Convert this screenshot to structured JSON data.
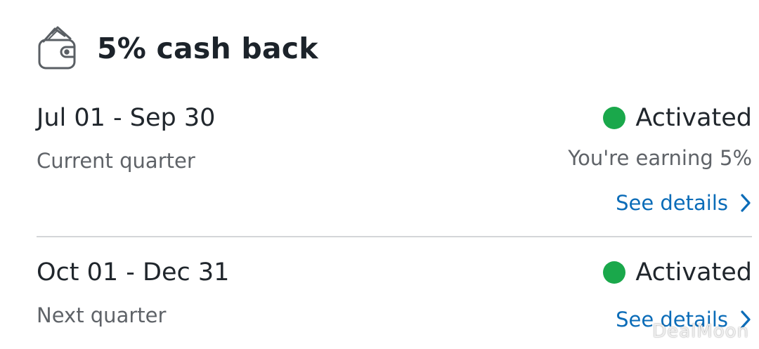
{
  "header": {
    "icon": "wallet-icon",
    "title": "5% cash back"
  },
  "colors": {
    "activated_green": "#1aa84b",
    "link_blue": "#0b6cb8"
  },
  "quarters": [
    {
      "date_range": "Jul 01 - Sep 30",
      "period_label": "Current quarter",
      "status": "Activated",
      "earning_text": "You're earning 5%",
      "details_label": "See details"
    },
    {
      "date_range": "Oct 01 - Dec 31",
      "period_label": "Next quarter",
      "status": "Activated",
      "details_label": "See details"
    }
  ],
  "watermark": "DealMoon"
}
